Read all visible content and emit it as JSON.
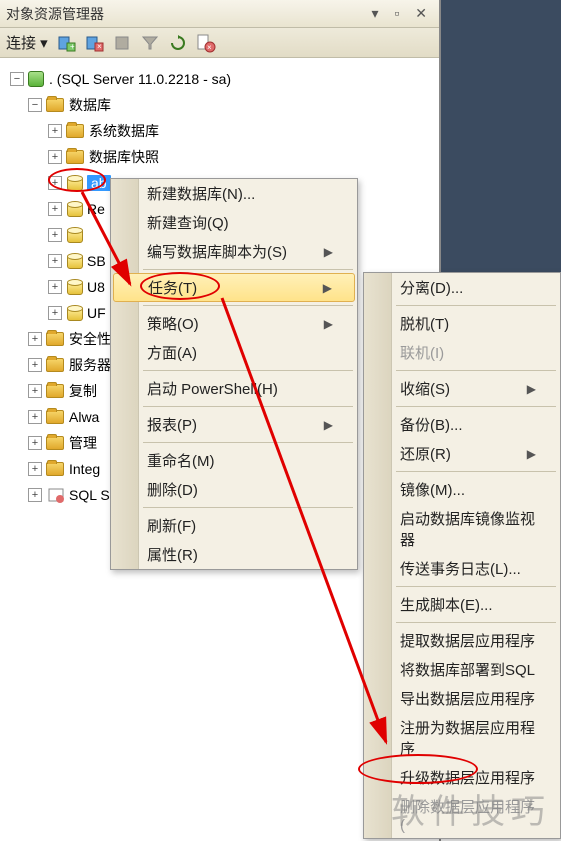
{
  "titlebar": {
    "title": "对象资源管理器",
    "icons": "▾ ▫ ✕"
  },
  "connectbar": {
    "label": "连接 ▾"
  },
  "tree": {
    "root": {
      "label": ". (SQL Server 11.0.2218 - sa)"
    },
    "db_folder": "数据库",
    "sys_db": "系统数据库",
    "snapshot": "数据库快照",
    "selected_db": "ab",
    "db_re": "Re",
    "db_blank": "",
    "db_sb": "SB",
    "db_u8": "U8",
    "db_uf": "UF",
    "security": "安全性",
    "server_obj": "服务器",
    "replication": "复制",
    "always": "Alwa",
    "mgmt": "管理",
    "integ": "Integ",
    "sql": "SQL S"
  },
  "menu1": {
    "new_db": "新建数据库(N)...",
    "new_query": "新建查询(Q)",
    "script_as": "编写数据库脚本为(S)",
    "tasks": "任务(T)",
    "policies": "策略(O)",
    "facets": "方面(A)",
    "powershell": "启动 PowerShell(H)",
    "reports": "报表(P)",
    "rename": "重命名(M)",
    "delete": "删除(D)",
    "refresh": "刷新(F)",
    "properties": "属性(R)"
  },
  "menu2": {
    "detach": "分离(D)...",
    "offline": "脱机(T)",
    "online": "联机(I)",
    "shrink": "收缩(S)",
    "backup": "备份(B)...",
    "restore": "还原(R)",
    "mirror": "镜像(M)...",
    "mirror_monitor": "启动数据库镜像监视器",
    "ship_log": "传送事务日志(L)...",
    "gen_script": "生成脚本(E)...",
    "extract_dac": "提取数据层应用程序",
    "deploy_sql": "将数据库部署到SQL",
    "export_dac": "导出数据层应用程序",
    "register_dac": "注册为数据层应用程序",
    "upgrade_dac": "升级数据层应用程序",
    "delete_dac": "删除数据层应用程序("
  },
  "watermark": "软件技巧"
}
